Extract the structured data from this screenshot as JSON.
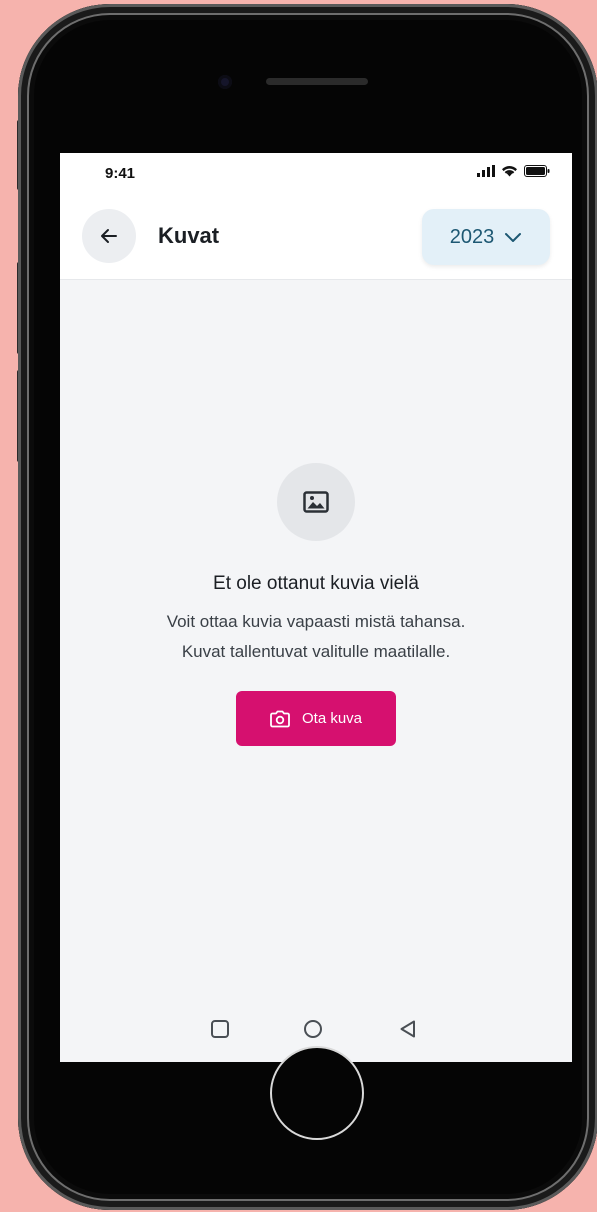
{
  "status_bar": {
    "time": "9:41",
    "icons": [
      "cellular-signal-icon",
      "wifi-icon",
      "battery-icon"
    ]
  },
  "header": {
    "back_icon": "arrow-left-icon",
    "title": "Kuvat",
    "year_select": {
      "value": "2023",
      "icon": "chevron-down-icon"
    }
  },
  "empty_state": {
    "icon": "image-icon",
    "title": "Et ole ottanut kuvia vielä",
    "description_line1": "Voit ottaa kuvia vapaasti mistä tahansa.",
    "description_line2": "Kuvat tallentuvat valitulle maatilalle.",
    "button": {
      "label": "Ota kuva",
      "icon": "camera-icon"
    }
  },
  "nav_bar": {
    "icons": [
      "square-recents-icon",
      "circle-home-icon",
      "triangle-back-icon"
    ]
  },
  "colors": {
    "background": "#f6b3ad",
    "accent": "#d6106f",
    "year_select_bg": "#e3f0f8",
    "year_select_text": "#1d5873"
  }
}
